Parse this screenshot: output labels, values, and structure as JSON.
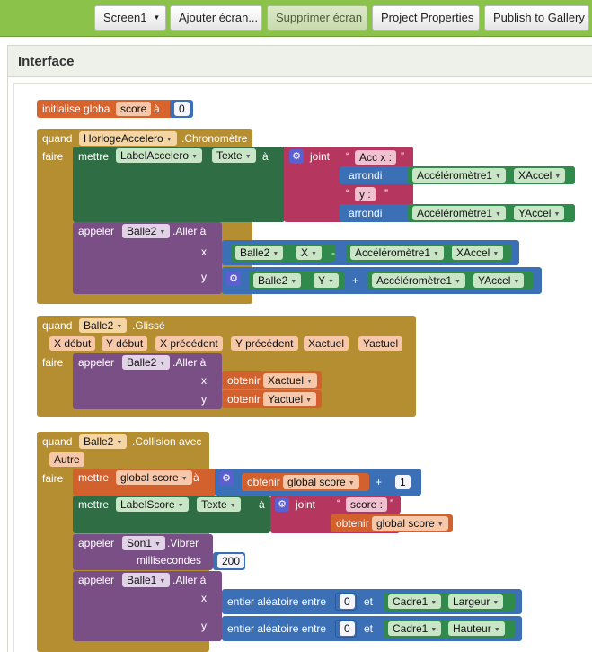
{
  "toolbar": {
    "screen_select": "Screen1",
    "add_screen": "Ajouter écran...",
    "remove_screen": "Supprimer écran",
    "project_properties": "Project Properties",
    "publish": "Publish to Gallery"
  },
  "panel": {
    "title": "Interface"
  },
  "blocks": {
    "init": {
      "label": "initialise globa",
      "var": "score",
      "to": "à",
      "value": "0"
    },
    "clock": {
      "when": "quand",
      "component": "HorlogeAccelero",
      "event": ".Chronomètre",
      "do": "faire",
      "set": "mettre",
      "set_component": "LabelAccelero",
      "set_prop": "Texte",
      "to": "à",
      "join": "joint",
      "str1": "Acc x :",
      "round1": "arrondi",
      "acc1": "Accéléromètre1",
      "xaccel": "XAccel",
      "str2": "y :",
      "round2": "arrondi",
      "acc2": "Accéléromètre1",
      "yaccel": "YAccel",
      "call": "appeler",
      "call_component": "Balle2",
      "method": ".Aller à",
      "x": "x",
      "y": "y",
      "x_ball": "Balle2",
      "x_ball_prop": "X",
      "minus": "-",
      "x_acc": "Accéléromètre1",
      "x_acc_prop": "XAccel",
      "y_ball": "Balle2",
      "y_ball_prop": "Y",
      "plus": "+",
      "y_acc": "Accéléromètre1",
      "y_acc_prop": "YAccel"
    },
    "flung": {
      "when": "quand",
      "component": "Balle2",
      "event": ".Glissé",
      "params": [
        "X début",
        "Y début",
        "X précédent",
        "Y précédent",
        "Xactuel",
        "Yactuel"
      ],
      "do": "faire",
      "call": "appeler",
      "call_component": "Balle2",
      "method": ".Aller à",
      "x": "x",
      "y": "y",
      "get": "obtenir",
      "x_var": "Xactuel",
      "y_var": "Yactuel"
    },
    "collide": {
      "when": "quand",
      "component": "Balle2",
      "event": ".Collision avec",
      "param": "Autre",
      "do": "faire",
      "set": "mettre",
      "set_var": "global score",
      "to": "à",
      "get": "obtenir",
      "get_var": "global score",
      "plus": "+",
      "one": "1",
      "set2": "mettre",
      "set2_component": "LabelScore",
      "set2_prop": "Texte",
      "to2": "à",
      "join": "joint",
      "str": "score :",
      "get2": "obtenir",
      "get2_var": "global score",
      "call1": "appeler",
      "call1_component": "Son1",
      "call1_method": ".Vibrer",
      "ms": "millisecondes",
      "ms_val": "200",
      "call2": "appeler",
      "call2_component": "Balle1",
      "call2_method": ".Aller à",
      "x": "x",
      "y": "y",
      "rand1": "entier aléatoire entre",
      "rand1_from": "0",
      "and1": "et",
      "rand1_comp": "Cadre1",
      "rand1_prop": "Largeur",
      "rand2": "entier aléatoire entre",
      "rand2_from": "0",
      "and2": "et",
      "rand2_comp": "Cadre1",
      "rand2_prop": "Hauteur"
    }
  }
}
